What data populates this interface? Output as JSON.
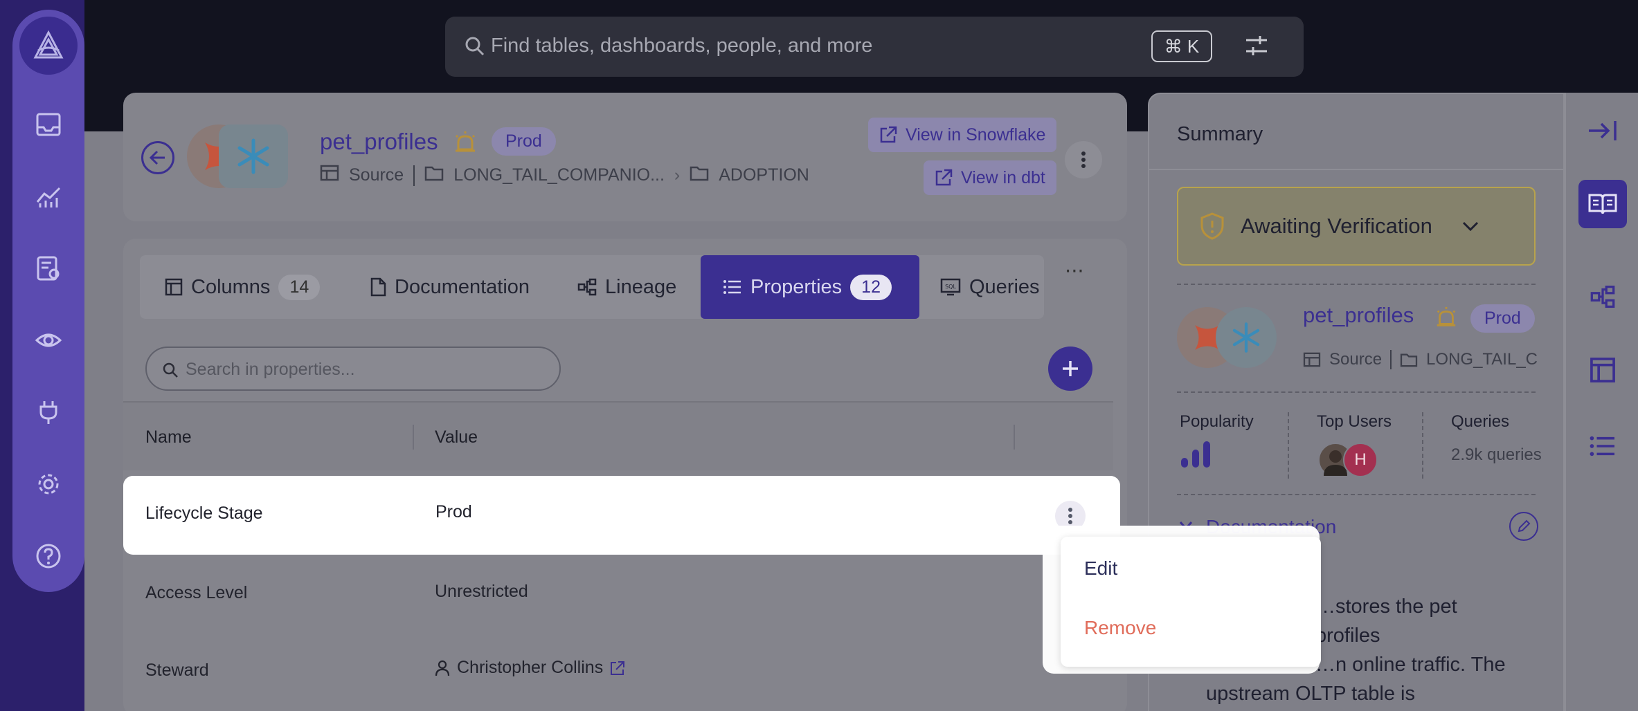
{
  "search": {
    "placeholder": "Find tables, dashboards, people, and more",
    "shortcut": "⌘ K"
  },
  "entity": {
    "name": "pet_profiles",
    "badge": "Prod",
    "breadcrumbs": [
      "Source",
      "LONG_TAIL_COMPANIO...",
      "ADOPTION"
    ],
    "actions": {
      "view_snowflake": "View in Snowflake",
      "view_dbt": "View in dbt"
    }
  },
  "tabs": [
    {
      "label": "Columns",
      "count": "14"
    },
    {
      "label": "Documentation"
    },
    {
      "label": "Lineage"
    },
    {
      "label": "Properties",
      "count": "12"
    },
    {
      "label": "Queries"
    }
  ],
  "tab_more": "···",
  "properties": {
    "search_placeholder": "Search in properties...",
    "columns": {
      "name": "Name",
      "value": "Value"
    },
    "rows": [
      {
        "name": "Lifecycle Stage",
        "value": "Prod"
      },
      {
        "name": "Access Level",
        "value": "Unrestricted"
      },
      {
        "name": "Steward",
        "value": "Christopher Collins"
      }
    ]
  },
  "menu": {
    "edit": "Edit",
    "remove": "Remove"
  },
  "summary": {
    "title": "Summary",
    "verification": "Awaiting Verification",
    "entity_name": "pet_profiles",
    "badge": "Prod",
    "breadcrumbs": [
      "Source",
      "LONG_TAIL_C"
    ],
    "stats": {
      "popularity": "Popularity",
      "top_users": "Top Users",
      "queries": "Queries",
      "queries_value": "2.9k queries"
    },
    "top_user_initial": "H",
    "documentation_title": "Documentation",
    "doc_heading_fragment": "v",
    "doc_text": [
      "…stores the pet profiles",
      "…n online traffic. The",
      "upstream OLTP table is"
    ]
  },
  "colors": {
    "accent": "#3b2f91",
    "brand_purple": "#5b4bb0",
    "danger": "#e06c5a",
    "warning": "#b8a34c"
  }
}
